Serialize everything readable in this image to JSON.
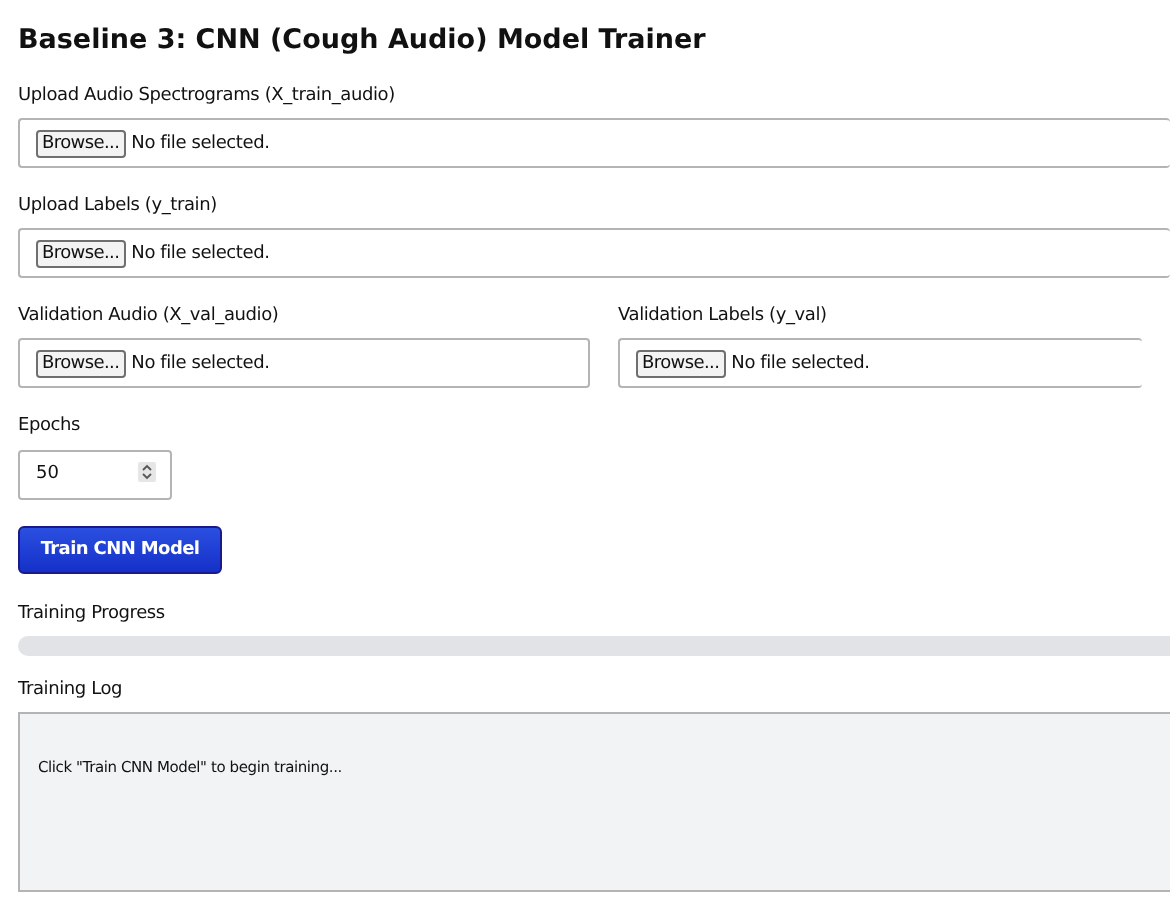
{
  "title": "Baseline 3: CNN (Cough Audio) Model Trainer",
  "uploads": [
    {
      "label": "Upload Audio Spectrograms (X_train_audio)",
      "button": "Browse...",
      "status": "No file selected."
    },
    {
      "label": "Upload Labels (y_train)",
      "button": "Browse...",
      "status": "No file selected."
    }
  ],
  "validation": [
    {
      "label": "Validation Audio (X_val_audio)",
      "button": "Browse...",
      "status": "No file selected."
    },
    {
      "label": "Validation Labels (y_val)",
      "button": "Browse...",
      "status": "No file selected."
    }
  ],
  "epochs": {
    "label": "Epochs",
    "value": "50"
  },
  "train_button": "Train CNN Model",
  "progress": {
    "label": "Training Progress",
    "level": 0
  },
  "log": {
    "label": "Training Log",
    "text": "Click \"Train CNN Model\" to begin training..."
  }
}
